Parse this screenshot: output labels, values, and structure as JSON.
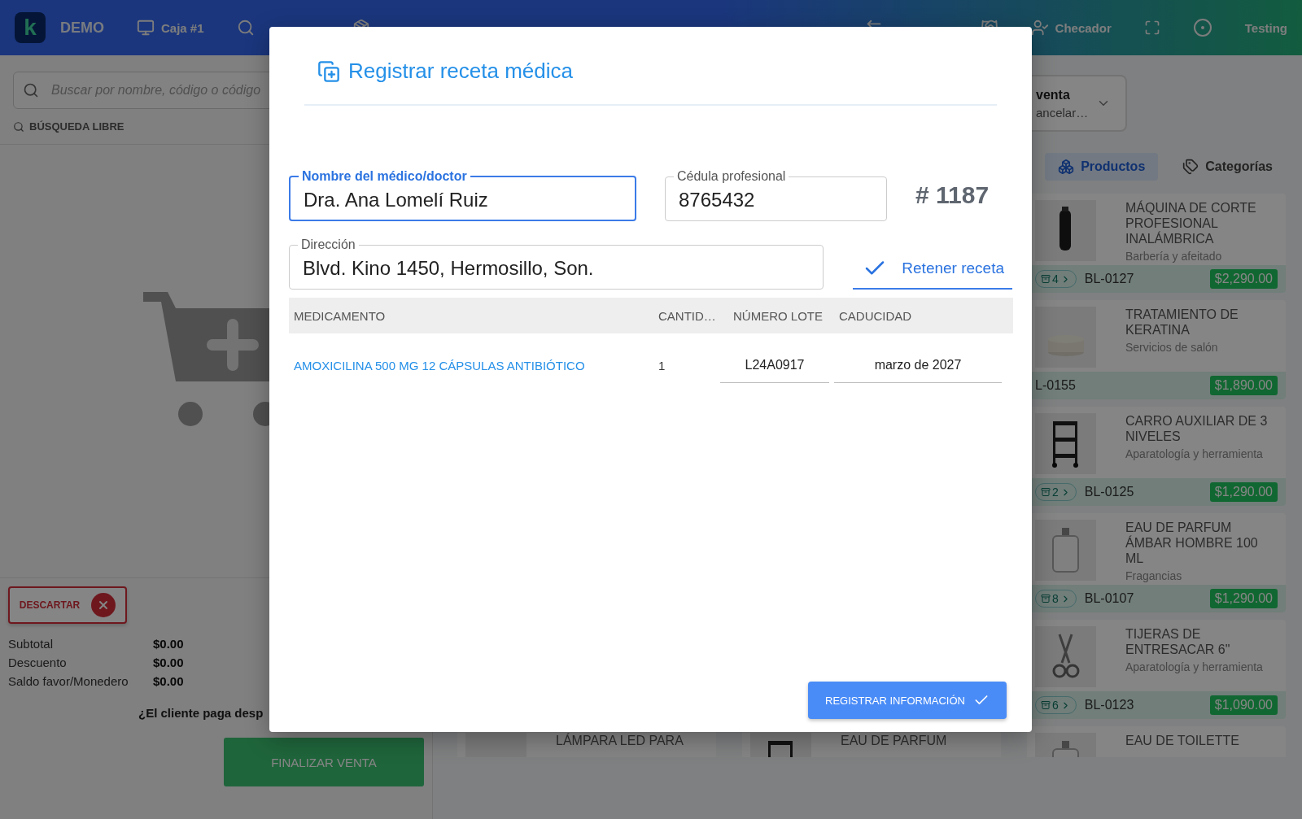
{
  "topbar": {
    "logo_letter": "k",
    "brand": "DEMO",
    "nav": [
      {
        "label": "Caja #1"
      }
    ],
    "right_nav": [
      {
        "label": "Checador"
      }
    ],
    "user": "Testing"
  },
  "left_panel": {
    "search": {
      "placeholder": "Buscar por nombre, código o código"
    },
    "free_search": "BÚSQUEDA LIBRE",
    "discard": "DESCARTAR",
    "totals": [
      {
        "label": "Subtotal",
        "value": "$0.00"
      },
      {
        "label": "Descuento",
        "value": "$0.00"
      },
      {
        "label": "Saldo favor/Monedero",
        "value": "$0.00"
      }
    ],
    "question": "¿El cliente paga desp",
    "finalize": "FINALIZAR VENTA"
  },
  "right_panel": {
    "sale_selector": {
      "title": "venta",
      "subtitle": "ancelar…"
    },
    "tabs": [
      {
        "label": "Productos",
        "selected": true
      },
      {
        "label": "Categorías",
        "selected": false
      }
    ],
    "products": [
      {
        "title": "MÁQUINA DE CORTE PROFESIONAL INALÁMBRICA",
        "category": "Barbería y afeitado",
        "stock": "4",
        "code": "BL-0127",
        "price": "$2,290.00"
      },
      {
        "title": "TRATAMIENTO DE KERATINA",
        "category": "Servicios de salón",
        "code": "L-0155",
        "price": "$1,890.00"
      },
      {
        "title": "CARRO AUXILIAR DE 3 NIVELES",
        "category": "Aparatología y herramienta",
        "stock": "2",
        "code": "BL-0125",
        "price": "$1,290.00"
      },
      {
        "title": "EAU DE PARFUM ÁMBAR HOMBRE 100 ML",
        "category": "Fragancias",
        "stock": "8",
        "code": "BL-0107",
        "price": "$1,290.00"
      },
      {
        "title": "TIJERAS DE ENTRESACAR 6\"",
        "category": "Aparatología y herramienta",
        "stock": "6",
        "code": "BL-0123",
        "price": "$1,090.00"
      }
    ],
    "bottom_row": [
      {
        "title": "LÁMPARA LED PARA"
      },
      {
        "title": "EAU DE PARFUM"
      },
      {
        "title": "EAU DE TOILETTE"
      }
    ]
  },
  "modal": {
    "title": "Registrar receta médica",
    "fields": [
      {
        "label": "Nombre del médico/doctor",
        "value": "Dra. Ana Lomelí Ruiz",
        "focused": true
      },
      {
        "label": "Cédula profesional",
        "value": "8765432",
        "focused": false
      }
    ],
    "number": "# 1187",
    "address": {
      "label": "Dirección",
      "value": "Blvd. Kino 1450, Hermosillo, Son.",
      "focused": false
    },
    "retain": {
      "label": "Retener receta",
      "checked": true
    },
    "table": {
      "columns": [
        "MEDICAMENTO",
        "CANTID…",
        "NÚMERO LOTE",
        "CADUCIDAD"
      ],
      "rows": [
        {
          "medicine": "AMOXICILINA 500 MG 12 CÁPSULAS ANTIBIÓTICO",
          "quantity": "1",
          "lot": "L24A0917",
          "expiry": "marzo de 2027"
        }
      ]
    },
    "submit": "REGISTRAR INFORMACIÓN"
  }
}
